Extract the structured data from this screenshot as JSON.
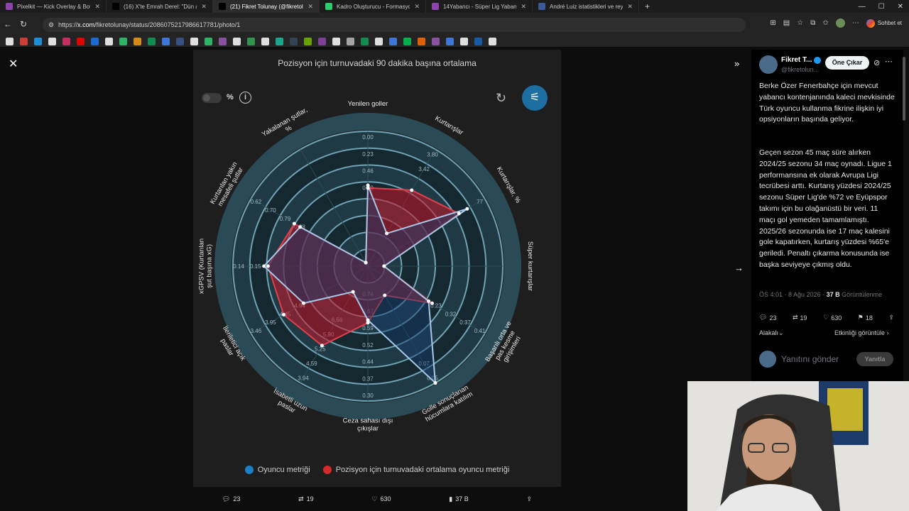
{
  "browser": {
    "tabs": [
      {
        "label": "Pixelkit — Kick Overlay & Bot",
        "color": "#8e44ad",
        "active": false
      },
      {
        "label": "(16) X'te Emrah Derel: \"Dün akşam",
        "color": "#000000",
        "active": false
      },
      {
        "label": "(21) Fikret Tolunay (@fikretolunay)",
        "color": "#000000",
        "active": true
      },
      {
        "label": "Kadro Oluşturucu - Formasyonlar",
        "color": "#2ecc71",
        "active": false
      },
      {
        "label": "14Yabancı - Süper Lig Yabancı Kur",
        "color": "#8e44ad",
        "active": false
      },
      {
        "label": "André Luiz istatistikleri ve reytingle",
        "color": "#3b5998",
        "active": false
      }
    ],
    "url_prefix": "https://",
    "url_domain": "x.com",
    "url_path": "/fikretolunay/status/2086075217986617781/photo/1",
    "profile_chat": "Sohbet et"
  },
  "chart": {
    "title": "Pozisyon için turnuvadaki 90 dakika başına ortalama",
    "pct_label": "%",
    "legend_player": "Oyuncu metriği",
    "legend_avg": "Pozisyon için turnuvadaki ortalama oyuncu metriği",
    "colors": {
      "player": "#1d7fc4",
      "avg": "#c0392b"
    }
  },
  "chart_data": {
    "type": "radar",
    "axes": [
      {
        "label": "Yenilen goller",
        "ticks": [
          "0.00",
          "0.23",
          "0.46",
          "0.70"
        ]
      },
      {
        "label": "Kurtarışlar",
        "ticks": [
          "3.80",
          "3.42"
        ]
      },
      {
        "label": "Kurtarışlar, %",
        "ticks": [
          "77"
        ]
      },
      {
        "label": "Süper kurtarışlar",
        "ticks": []
      },
      {
        "label": "Başarılı orta ve pas kesme girişimleri",
        "ticks": [
          "0.41",
          "0.37",
          "0.32",
          "0.23"
        ]
      },
      {
        "label": "Golle sonuçlanan hücumlara katılım",
        "ticks": [
          "0.05",
          "0.07"
        ]
      },
      {
        "label": "Ceza sahası dışı çıkışlar",
        "ticks": [
          "0.30",
          "0.37",
          "0.44",
          "0.52",
          "0.59",
          "0.67",
          "0.74"
        ]
      },
      {
        "label": "İsabetli uzun paslar",
        "ticks": [
          "3.94",
          "4.59",
          "5.25",
          "5.90",
          "6.56"
        ]
      },
      {
        "label": "İleriletici açık paslar",
        "ticks": [
          "3.46",
          "3.95",
          "4.45",
          "4.94"
        ]
      },
      {
        "label": "xGPSV (Kurtarılan şut başına xG)",
        "ticks": [
          "0.14",
          "0.15"
        ]
      },
      {
        "label": "Kurtarılan yakın mesafeli şutlar",
        "ticks": [
          "0.62",
          "0.70",
          "0.79",
          "0.88"
        ]
      },
      {
        "label": "Yakalanan şutlar, %",
        "ticks": []
      }
    ],
    "series": [
      {
        "name": "Oyuncu metriği",
        "values": [
          0.6,
          0.28,
          0.85,
          0.12,
          0.52,
          1.0,
          0.4,
          0.22,
          0.55,
          0.77,
          0.58,
          0.03
        ]
      },
      {
        "name": "Pozisyon için turnuvadaki ortalama oyuncu metriği",
        "values": [
          0.58,
          0.65,
          0.78,
          0.12,
          0.55,
          0.25,
          0.42,
          0.68,
          0.72,
          0.74,
          0.63,
          0.03
        ]
      }
    ]
  },
  "photo_actions": {
    "replies": "23",
    "reposts": "19",
    "likes": "630",
    "views": "37 B"
  },
  "tweet": {
    "author": "Fikret T...",
    "handle": "@fikretolun...",
    "promote": "Öne Çıkar",
    "para1": "Berke Özer Fenerbahçe için mevcut yabancı kontenjanında kaleci mevkisinde Türk oyuncu kullanma fikrine ilişkin iyi opsiyonların başında geliyor.",
    "para2": "Geçen sezon 45 maç süre alırken 2024/25 sezonu 34 maç oynadı. Ligue 1 performansına ek olarak Avrupa Ligi tecrübesi arttı. Kurtarış yüzdesi 2024/25 sezonu Süper Lig'de %72 ve Eyüpspor takımı için bu olağanüstü bir veri. 11 maçı gol yemeden tamamlamıştı. 2025/26 sezonunda ise 17 maç kalesini gole kapatırken, kurtarış yüzdesi %65'e geriledi. Penaltı çıkarma konusunda ise başka seviyeye çıkmış oldu.",
    "time": "ÖS 4:01 · 8 Ağu 2026 · ",
    "views": "37 B",
    "views_label": " Görüntülenme",
    "replies": "23",
    "reposts": "19",
    "likes": "630",
    "bookmarks": "18",
    "sort": "Alakalı",
    "engagements": "Etkinliği görüntüle",
    "reply_placeholder": "Yanıtını gönder",
    "reply_button": "Yanıtla"
  }
}
